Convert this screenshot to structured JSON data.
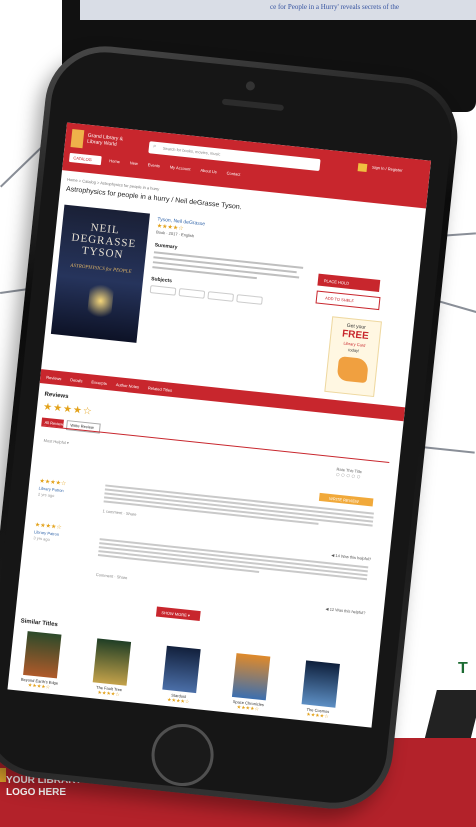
{
  "background": {
    "monitor_caption": "ce for People in a Hurry' reveals secrets of the",
    "side_teaser": "T",
    "logo_placeholder": "YOUR LIBRARY'S LOGO HERE"
  },
  "screen": {
    "header": {
      "site_name": "Grand Library & Library World",
      "search_placeholder": "Search for books, movies, music",
      "catalog_label": "CATALOG",
      "nav_links": [
        "Home",
        "New",
        "Events",
        "My Account",
        "About Us",
        "Contact"
      ],
      "signin_label": "Sign In / Register"
    },
    "breadcrumb": "Home > Catalog > Astrophysics for people in a hurry",
    "page_title": "Astrophysics for people in a hurry / Neil deGrasse Tyson.",
    "book": {
      "cover_author": "NEIL DEGRASSE TYSON",
      "cover_title": "ASTROPHYSICS for PEOPLE",
      "author_link": "Tyson, Neil deGrasse",
      "rating_stars": "★★★★☆",
      "format": "Book · 2017 · English",
      "summary_heading": "Summary",
      "subjects_heading": "Subjects"
    },
    "actions": {
      "place_hold": "PLACE HOLD",
      "add_to_shelf": "ADD TO SHELF"
    },
    "promo": {
      "line1": "Get your",
      "line2": "FREE",
      "line3": "Library Card",
      "line4": "today!"
    },
    "tabs": [
      "Reviews",
      "Details",
      "Excerpts",
      "Author Notes",
      "Related Titles"
    ],
    "reviews": {
      "heading": "Reviews",
      "big_stars": "★★★★☆",
      "tab_all": "All Reviews",
      "tab_write": "Write Review",
      "sort_text": "Most Helpful ▾",
      "rate_label": "Rate This Title",
      "rate_circles": "○○○○○",
      "write_btn": "WRITE REVIEW",
      "items": [
        {
          "stars": "★★★★☆",
          "name": "Library Patron",
          "date": "2 yrs ago",
          "meta": "1 comment · Share",
          "right": ""
        },
        {
          "stars": "★★★★☆",
          "name": "Library Patron",
          "date": "3 yrs ago",
          "meta": "",
          "right": "◀ 14    Was this helpful?"
        },
        {
          "stars": "",
          "name": "",
          "date": "",
          "meta": "Comment · Share",
          "right": "◀ 12    Was this helpful?"
        }
      ],
      "show_more": "SHOW MORE ▾"
    },
    "similar": {
      "heading": "Similar Titles",
      "items": [
        {
          "title": "Beyond Earth's Edge",
          "stars": "★★★★☆",
          "color1": "#2c4a2a",
          "color2": "#b05a2a"
        },
        {
          "title": "The Fault Tree",
          "stars": "★★★★☆",
          "color1": "#1f3e25",
          "color2": "#c4a24a"
        },
        {
          "title": "Stardust",
          "stars": "★★★★☆",
          "color1": "#12203c",
          "color2": "#4b6fa8"
        },
        {
          "title": "Space Chronicles",
          "stars": "★★★★☆",
          "color1": "#e08a2a",
          "color2": "#3b6fb0"
        },
        {
          "title": "The Cosmos",
          "stars": "★★★★☆",
          "color1": "#0e1f3b",
          "color2": "#5d8fc4"
        }
      ]
    }
  }
}
